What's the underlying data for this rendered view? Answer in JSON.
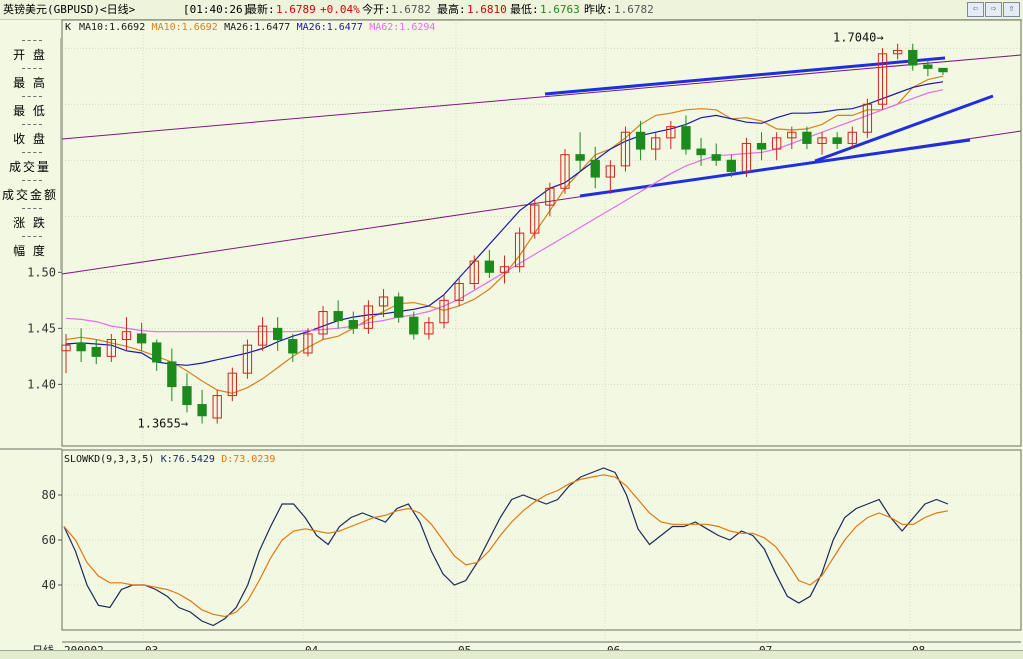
{
  "header": {
    "instrument": "英镑美元(GBPUSD)<日线>",
    "time": "[01:40:26]",
    "last_label": "最新:",
    "last_value": "1.6789",
    "change_value": "+0.04%",
    "open_label": "今开:",
    "open_value": "1.6782",
    "high_label": "最高:",
    "high_value": "1.6810",
    "low_label": "最低:",
    "low_value": "1.6763",
    "prev_label": "昨收:",
    "prev_value": "1.6782",
    "nav_buttons": [
      "⇦",
      "⇨",
      "⇧"
    ]
  },
  "sidebar": {
    "items": [
      "开 盘",
      "最 高",
      "最 低",
      "收 盘",
      "成交量",
      "成交金额",
      "涨 跌",
      "幅 度"
    ]
  },
  "colors": {
    "background": "#f2f8e2",
    "up_candle": "#d0261c",
    "down_candle": "#1c8a1c",
    "ma10": "#d8801c",
    "ma26": "#1a1aa8",
    "ma62": "#e070e8",
    "trendline_thick": "#1f2fe0",
    "trendline_thin": "#7a1a7a",
    "slowk": "#1a2a5a",
    "slowd": "#e07810"
  },
  "chart_data": [
    {
      "type": "candlestick",
      "title": "K",
      "legend": [
        {
          "name": "MA10",
          "value": "1.6692",
          "color": "#1a1a1a"
        },
        {
          "name": "MA10",
          "value": "1.6692",
          "color": "#d8801c"
        },
        {
          "name": "MA26",
          "value": "1.6477",
          "color": "#1a1a1a"
        },
        {
          "name": "MA26",
          "value": "1.6477",
          "color": "#1a1aa8"
        },
        {
          "name": "MA62",
          "value": "1.6294",
          "color": "#e070e8"
        }
      ],
      "yticks": [
        "1.40",
        "1.45",
        "1.50"
      ],
      "ylim": [
        1.345,
        1.71
      ],
      "annotations": {
        "high": "1.7040",
        "low": "1.3655"
      },
      "series": [
        {
          "name": "MA10",
          "values": [
            1.44,
            1.442,
            1.44,
            1.437,
            1.434,
            1.43,
            1.425,
            1.42,
            1.412,
            1.403,
            1.395,
            1.392,
            1.397,
            1.405,
            1.415,
            1.425,
            1.433,
            1.44,
            1.443,
            1.45,
            1.458,
            1.465,
            1.472,
            1.473,
            1.47,
            1.466,
            1.47,
            1.476,
            1.485,
            1.498,
            1.515,
            1.535,
            1.555,
            1.575,
            1.59,
            1.605,
            1.61,
            1.62,
            1.632,
            1.64,
            1.642,
            1.645,
            1.646,
            1.645,
            1.637,
            1.638,
            1.635,
            1.628,
            1.627,
            1.628,
            1.632,
            1.64,
            1.64,
            1.645,
            1.645,
            1.65,
            1.665,
            1.672,
            1.675
          ]
        },
        {
          "name": "MA26",
          "values": [
            1.436,
            1.437,
            1.436,
            1.435,
            1.43,
            1.428,
            1.42,
            1.418,
            1.417,
            1.419,
            1.422,
            1.425,
            1.428,
            1.432,
            1.438,
            1.443,
            1.447,
            1.452,
            1.457,
            1.46,
            1.462,
            1.463,
            1.465,
            1.467,
            1.47,
            1.48,
            1.495,
            1.51,
            1.525,
            1.54,
            1.555,
            1.565,
            1.575,
            1.58,
            1.59,
            1.6,
            1.61,
            1.617,
            1.622,
            1.625,
            1.628,
            1.632,
            1.638,
            1.64,
            1.637,
            1.634,
            1.633,
            1.638,
            1.642,
            1.642,
            1.643,
            1.645,
            1.646,
            1.65,
            1.655,
            1.66,
            1.665,
            1.668,
            1.67
          ]
        },
        {
          "name": "MA62",
          "values": [
            1.459,
            1.458,
            1.456,
            1.452,
            1.45,
            1.448,
            1.447,
            1.447,
            1.447,
            1.447,
            1.447,
            1.447,
            1.447,
            1.447,
            1.447,
            1.447,
            1.448,
            1.449,
            1.45,
            1.452,
            1.455,
            1.457,
            1.46,
            1.462,
            1.465,
            1.47,
            1.476,
            1.484,
            1.492,
            1.5,
            1.508,
            1.516,
            1.524,
            1.532,
            1.54,
            1.548,
            1.556,
            1.564,
            1.572,
            1.58,
            1.588,
            1.595,
            1.6,
            1.604,
            1.605,
            1.606,
            1.607,
            1.61,
            1.615,
            1.62,
            1.625,
            1.63,
            1.635,
            1.64,
            1.645,
            1.65,
            1.655,
            1.66,
            1.663
          ]
        }
      ],
      "candles": [
        [
          1.43,
          1.445,
          1.41,
          1.435
        ],
        [
          1.437,
          1.45,
          1.42,
          1.43
        ],
        [
          1.433,
          1.44,
          1.418,
          1.425
        ],
        [
          1.425,
          1.445,
          1.42,
          1.44
        ],
        [
          1.44,
          1.46,
          1.43,
          1.447
        ],
        [
          1.445,
          1.455,
          1.43,
          1.437
        ],
        [
          1.437,
          1.44,
          1.412,
          1.42
        ],
        [
          1.42,
          1.432,
          1.385,
          1.398
        ],
        [
          1.398,
          1.41,
          1.375,
          1.382
        ],
        [
          1.382,
          1.395,
          1.365,
          1.372
        ],
        [
          1.37,
          1.395,
          1.365,
          1.39
        ],
        [
          1.39,
          1.415,
          1.385,
          1.41
        ],
        [
          1.41,
          1.44,
          1.405,
          1.435
        ],
        [
          1.435,
          1.46,
          1.43,
          1.452
        ],
        [
          1.45,
          1.46,
          1.43,
          1.44
        ],
        [
          1.44,
          1.445,
          1.42,
          1.428
        ],
        [
          1.428,
          1.45,
          1.425,
          1.445
        ],
        [
          1.445,
          1.47,
          1.44,
          1.465
        ],
        [
          1.465,
          1.475,
          1.45,
          1.457
        ],
        [
          1.457,
          1.465,
          1.445,
          1.45
        ],
        [
          1.45,
          1.475,
          1.445,
          1.47
        ],
        [
          1.47,
          1.485,
          1.46,
          1.478
        ],
        [
          1.478,
          1.482,
          1.455,
          1.46
        ],
        [
          1.46,
          1.465,
          1.44,
          1.445
        ],
        [
          1.445,
          1.46,
          1.44,
          1.455
        ],
        [
          1.455,
          1.48,
          1.45,
          1.475
        ],
        [
          1.475,
          1.495,
          1.47,
          1.49
        ],
        [
          1.49,
          1.515,
          1.485,
          1.51
        ],
        [
          1.51,
          1.52,
          1.495,
          1.5
        ],
        [
          1.5,
          1.515,
          1.49,
          1.505
        ],
        [
          1.505,
          1.54,
          1.5,
          1.535
        ],
        [
          1.535,
          1.565,
          1.53,
          1.56
        ],
        [
          1.56,
          1.58,
          1.55,
          1.575
        ],
        [
          1.575,
          1.61,
          1.57,
          1.605
        ],
        [
          1.605,
          1.625,
          1.59,
          1.6
        ],
        [
          1.6,
          1.612,
          1.575,
          1.585
        ],
        [
          1.585,
          1.6,
          1.57,
          1.595
        ],
        [
          1.595,
          1.63,
          1.59,
          1.625
        ],
        [
          1.625,
          1.635,
          1.6,
          1.61
        ],
        [
          1.61,
          1.625,
          1.6,
          1.62
        ],
        [
          1.62,
          1.635,
          1.61,
          1.63
        ],
        [
          1.63,
          1.64,
          1.605,
          1.61
        ],
        [
          1.61,
          1.62,
          1.595,
          1.605
        ],
        [
          1.605,
          1.615,
          1.595,
          1.6
        ],
        [
          1.6,
          1.605,
          1.585,
          1.59
        ],
        [
          1.59,
          1.62,
          1.585,
          1.615
        ],
        [
          1.615,
          1.625,
          1.6,
          1.61
        ],
        [
          1.61,
          1.625,
          1.6,
          1.62
        ],
        [
          1.62,
          1.63,
          1.61,
          1.625
        ],
        [
          1.625,
          1.63,
          1.61,
          1.615
        ],
        [
          1.615,
          1.625,
          1.605,
          1.62
        ],
        [
          1.62,
          1.625,
          1.61,
          1.615
        ],
        [
          1.615,
          1.63,
          1.61,
          1.625
        ],
        [
          1.625,
          1.655,
          1.62,
          1.65
        ],
        [
          1.65,
          1.7,
          1.645,
          1.695
        ],
        [
          1.695,
          1.704,
          1.69,
          1.698
        ],
        [
          1.698,
          1.704,
          1.68,
          1.685
        ],
        [
          1.685,
          1.69,
          1.675,
          1.682
        ],
        [
          1.682,
          1.681,
          1.676,
          1.679
        ]
      ],
      "xticks": [
        "2009|02",
        "03",
        "04",
        "05",
        "06",
        "07",
        "08"
      ]
    },
    {
      "type": "line",
      "title": "SLOWKD(9,3,3,5)",
      "legend": [
        {
          "name": "K",
          "value": "76.5429",
          "color": "#1a2a5a"
        },
        {
          "name": "D",
          "value": "73.0239",
          "color": "#e07810"
        }
      ],
      "yticks": [
        "40",
        "60",
        "80"
      ],
      "ylim": [
        20,
        100
      ],
      "series": [
        {
          "name": "K",
          "values": [
            66,
            55,
            40,
            31,
            30,
            38,
            40,
            40,
            38,
            35,
            30,
            28,
            24,
            22,
            25,
            30,
            40,
            55,
            66,
            76,
            76,
            70,
            62,
            58,
            66,
            70,
            72,
            70,
            68,
            74,
            76,
            68,
            55,
            45,
            40,
            42,
            50,
            60,
            70,
            78,
            80,
            78,
            76,
            78,
            84,
            88,
            90,
            92,
            90,
            80,
            65,
            58,
            62,
            66,
            66,
            68,
            65,
            62,
            60,
            64,
            62,
            56,
            45,
            35,
            32,
            35,
            45,
            60,
            70,
            74,
            76,
            78,
            70,
            64,
            70,
            76,
            78,
            76
          ]
        },
        {
          "name": "D",
          "values": [
            66,
            60,
            50,
            44,
            41,
            41,
            40,
            40,
            39,
            38,
            36,
            33,
            29,
            27,
            26,
            28,
            33,
            42,
            52,
            60,
            64,
            65,
            64,
            63,
            64,
            66,
            68,
            70,
            71,
            73,
            74,
            72,
            67,
            60,
            53,
            49,
            50,
            55,
            62,
            68,
            73,
            77,
            80,
            82,
            85,
            87,
            88,
            89,
            88,
            84,
            78,
            72,
            68,
            67,
            67,
            67,
            67,
            66,
            64,
            63,
            63,
            61,
            57,
            50,
            42,
            40,
            44,
            52,
            60,
            66,
            70,
            72,
            70,
            67,
            67,
            70,
            72,
            73
          ]
        }
      ]
    }
  ],
  "bottom_label": "日线"
}
